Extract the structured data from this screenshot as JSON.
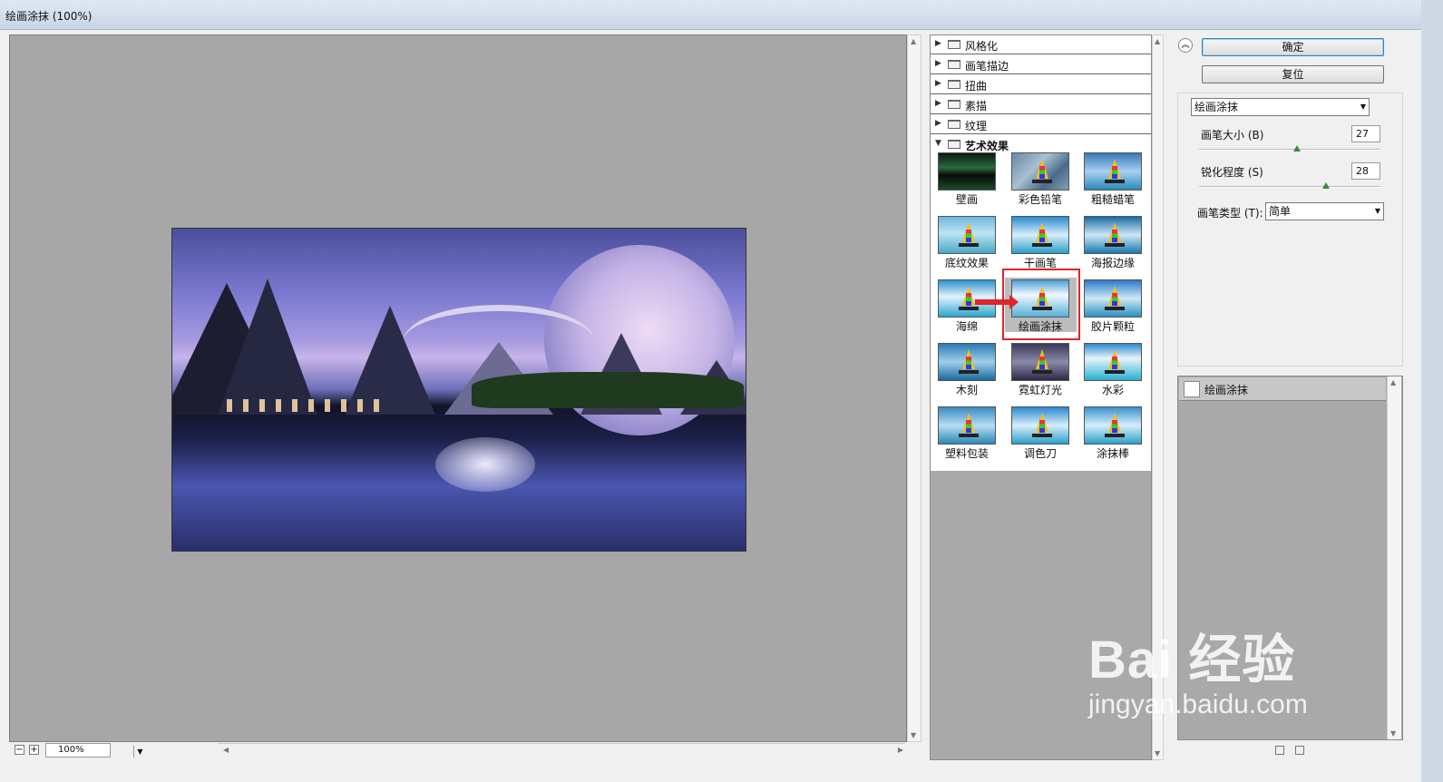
{
  "window": {
    "title": "绘画涂抹 (100%)"
  },
  "preview": {
    "zoom": "100%",
    "zoom_out": "−",
    "zoom_in": "+"
  },
  "categories": [
    {
      "label": "风格化",
      "open": false
    },
    {
      "label": "画笔描边",
      "open": false
    },
    {
      "label": "扭曲",
      "open": false
    },
    {
      "label": "素描",
      "open": false
    },
    {
      "label": "纹理",
      "open": false
    },
    {
      "label": "艺术效果",
      "open": true
    }
  ],
  "filters": [
    "壁画",
    "彩色铅笔",
    "粗糙蜡笔",
    "底纹效果",
    "干画笔",
    "海报边缘",
    "海绵",
    "绘画涂抹",
    "胶片颗粒",
    "木刻",
    "霓虹灯光",
    "水彩",
    "塑料包装",
    "调色刀",
    "涂抹棒"
  ],
  "selected_filter": "绘画涂抹",
  "buttons": {
    "ok": "确定",
    "reset": "复位"
  },
  "settings": {
    "filter_select": "绘画涂抹",
    "brush_size_label": "画笔大小 (B)",
    "brush_size": "27",
    "brush_size_level": 0.54,
    "sharpness_label": "锐化程度 (S)",
    "sharpness": "28",
    "sharpness_level": 0.7,
    "brush_type_label": "画笔类型 (T):",
    "brush_type": "简单"
  },
  "layers": [
    {
      "name": "绘画涂抹"
    }
  ],
  "watermark": {
    "logo": "Bai 经验",
    "url": "jingyan.baidu.com"
  },
  "icons": {
    "collapse": "double-chevron-up-icon",
    "dropdown": "triangle-down-icon",
    "folder": "folder-icon",
    "expand": "triangle-right-icon"
  }
}
